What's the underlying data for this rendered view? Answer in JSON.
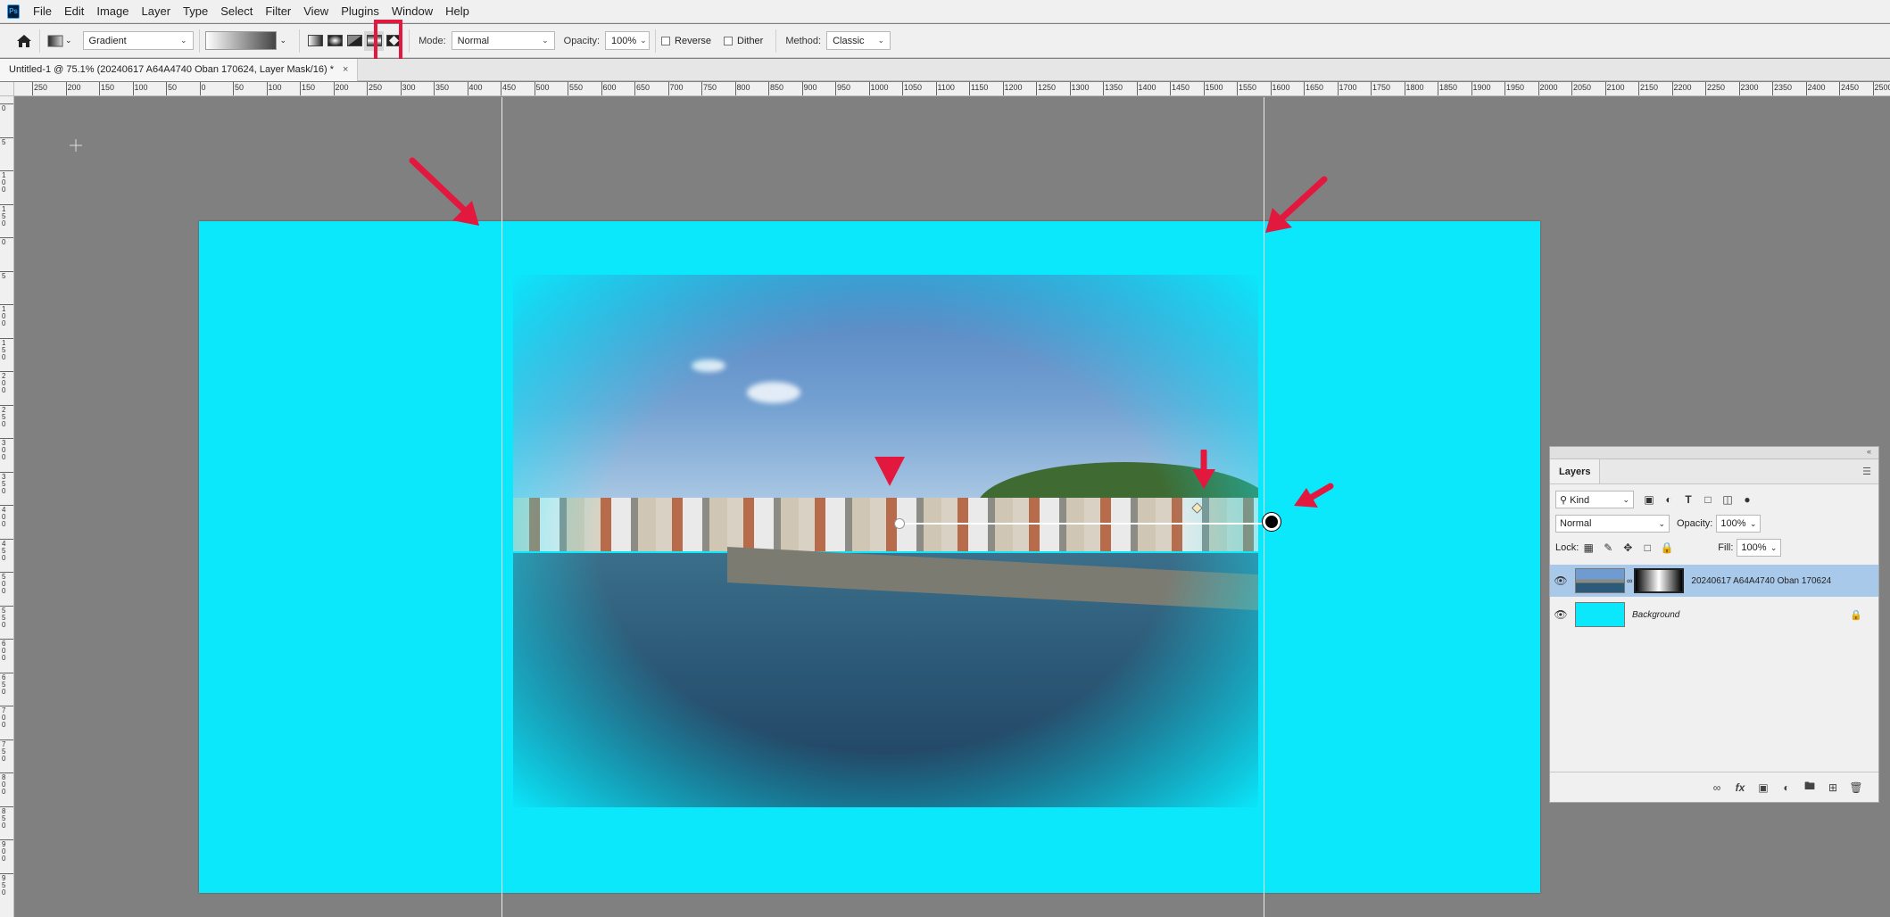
{
  "app": {
    "logo_text": "Ps"
  },
  "menu": [
    "File",
    "Edit",
    "Image",
    "Layer",
    "Type",
    "Select",
    "Filter",
    "View",
    "Plugins",
    "Window",
    "Help"
  ],
  "options_bar": {
    "preset": "Gradient",
    "mode_label": "Mode:",
    "mode_value": "Normal",
    "opacity_label": "Opacity:",
    "opacity_value": "100%",
    "reverse_label": "Reverse",
    "dither_label": "Dither",
    "method_label": "Method:",
    "method_value": "Classic",
    "gradient_types": [
      "linear-gradient-icon",
      "radial-gradient-icon",
      "angle-gradient-icon",
      "reflected-gradient-icon",
      "diamond-gradient-icon"
    ],
    "selected_gradient_type": "reflected-gradient-icon"
  },
  "document": {
    "tab_title": "Untitled-1 @ 75.1% (20240617 A64A4740 Oban  170624, Layer Mask/16) *",
    "close_glyph": "×",
    "canvas_color": "#0be8fc"
  },
  "ruler": {
    "top_labels": [
      "250",
      "200",
      "150",
      "100",
      "50",
      "0",
      "50",
      "100",
      "150",
      "200",
      "250",
      "300",
      "350",
      "400",
      "450",
      "500",
      "550",
      "600",
      "650",
      "700",
      "750",
      "800",
      "850",
      "900",
      "950",
      "1000",
      "1050",
      "1100",
      "1150",
      "1200",
      "1250",
      "1300",
      "1350",
      "1400",
      "1450",
      "1500",
      "1550",
      "1600",
      "1650",
      "1700",
      "1750",
      "1800",
      "1850",
      "1900",
      "1950",
      "2000",
      "2050",
      "2100",
      "2150",
      "2200",
      "2250",
      "2300",
      "2350",
      "2400",
      "2450",
      "2500"
    ],
    "left_labels": [
      "0",
      "5",
      "1 0 0",
      "1 5 0",
      "0",
      "5",
      "1 0 0",
      "1 5 0",
      "2 0 0",
      "2 5 0",
      "3 0 0",
      "3 5 0",
      "4 0 0",
      "4 5 0",
      "5 0 0",
      "5 5 0",
      "6 0 0",
      "6 5 0",
      "7 0 0",
      "7 5 0",
      "8 0 0",
      "8 5 0",
      "9 0 0",
      "9 5 0"
    ]
  },
  "layers_panel": {
    "tab": "Layers",
    "filter_kind": "Kind",
    "blend_mode": "Normal",
    "opacity_label": "Opacity:",
    "opacity_value": "100%",
    "lock_label": "Lock:",
    "fill_label": "Fill:",
    "fill_value": "100%",
    "layers": [
      {
        "name": "20240617 A64A4740 Oban  170624",
        "selected": true,
        "has_mask": true
      },
      {
        "name": "Background",
        "selected": false,
        "locked": true
      }
    ]
  },
  "colors": {
    "annotation_red": "#e3183f",
    "selected_layer": "#a9c9ea"
  }
}
